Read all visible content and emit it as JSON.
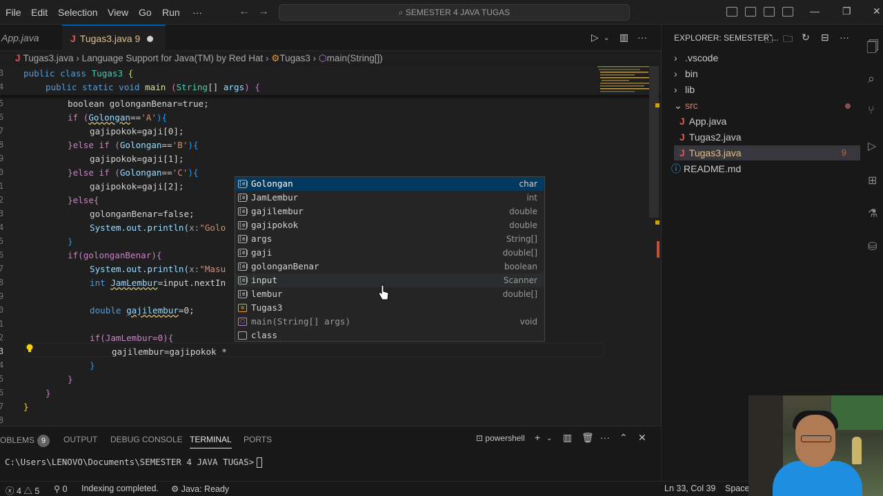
{
  "menu": {
    "file": "File",
    "edit": "Edit",
    "selection": "Selection",
    "view": "View",
    "go": "Go",
    "run": "Run",
    "more": "···"
  },
  "search": {
    "text": "SEMESTER 4 JAVA TUGAS"
  },
  "tabs": {
    "app": "App.java",
    "tugas3": "Tugas3.java",
    "tugas3_problems": "9",
    "tugas3_icon": "J"
  },
  "breadcrumb": {
    "file": "Tugas3.java",
    "ext": "Language Support for Java(TM) by Red Hat",
    "cls": "Tugas3",
    "method": "main(String[])"
  },
  "editor": {
    "sticky": [
      {
        "ln": "3",
        "code": "public class Tugas3 {"
      },
      {
        "ln": "4",
        "code": "public static void main (String[] args) {"
      }
    ],
    "line_numbers": [
      "5",
      "6",
      "7",
      "8",
      "9",
      "0",
      "1",
      "2",
      "3",
      "4",
      "5",
      "6",
      "7",
      "8",
      "9",
      "0",
      "1",
      "2",
      "3",
      "4",
      "5",
      "6",
      "7",
      "8"
    ],
    "lines": {
      "l5": "boolean golonganBenar=true;",
      "l6a": "if (",
      "l6b": "Golongan",
      "l6c": "==",
      "l6d": "'A'",
      "l6e": "){",
      "l7": "gajipokok=gaji[0];",
      "l8a": "}else if (",
      "l8b": "Golongan",
      "l8c": "==",
      "l8d": "'B'",
      "l8e": "){",
      "l9": "gajipokok=gaji[1];",
      "l10a": "}else if (",
      "l10b": "Golongan",
      "l10c": "==",
      "l10d": "'C'",
      "l10e": "){",
      "l11": "gajipokok=gaji[2];",
      "l12": "}else{",
      "l13": "golonganBenar=false;",
      "l14a": "System.out.println(",
      "l14b": "x:",
      "l14c": "\"Golo",
      "l15": "}",
      "l16": "if(golonganBenar){",
      "l17a": "System.out.println(",
      "l17b": "x:",
      "l17c": "\"Masu",
      "l18a": "int ",
      "l18b": "JamLembur",
      "l18c": "=input.nextIn",
      "l20a": "double ",
      "l20b": "gajilembur",
      "l20c": "=0;",
      "l22": "if(JamLembur=0){",
      "l23": "gajilembur=gajipokok *",
      "l24": "}",
      "l25": "}",
      "l26": "}",
      "l27": "}"
    }
  },
  "suggest": [
    {
      "label": "Golongan",
      "type": "char"
    },
    {
      "label": "JamLembur",
      "type": "int"
    },
    {
      "label": "gajilembur",
      "type": "double"
    },
    {
      "label": "gajipokok",
      "type": "double"
    },
    {
      "label": "args",
      "type": "String[]"
    },
    {
      "label": "gaji",
      "type": "double[]"
    },
    {
      "label": "golonganBenar",
      "type": "boolean"
    },
    {
      "label": "input",
      "type": "Scanner"
    },
    {
      "label": "lembur",
      "type": "double[]"
    },
    {
      "label": "Tugas3",
      "type": ""
    },
    {
      "label": "main(String[] args)",
      "type": "void"
    },
    {
      "label": "class",
      "type": ""
    }
  ],
  "explorer": {
    "title": "EXPLORER: SEMESTER ...",
    "items": [
      ".vscode",
      "bin",
      "lib",
      "src",
      "App.java",
      "Tugas2.java",
      "Tugas3.java",
      "README.md"
    ],
    "tugas3_badge": "9"
  },
  "panel": {
    "problems": "OBLEMS",
    "problems_count": "9",
    "output": "OUTPUT",
    "debug": "DEBUG CONSOLE",
    "terminal": "TERMINAL",
    "ports": "PORTS",
    "shell": "powershell",
    "prompt": "C:\\Users\\LENOVO\\Documents\\SEMESTER 4 JAVA TUGAS>"
  },
  "status": {
    "errors": "4",
    "warnings": "5",
    "ports": "0",
    "indexing": "Indexing completed.",
    "java": "Java: Ready",
    "position": "Ln 33, Col 39",
    "spaces": "Spaces"
  }
}
